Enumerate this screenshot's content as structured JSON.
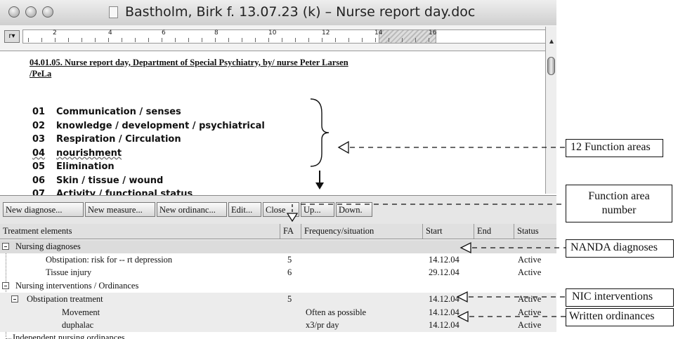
{
  "window": {
    "title": "Bastholm, Birk f. 13.07.23 (k) – Nurse report day.doc"
  },
  "ruler": {
    "button": "r▾",
    "numbers": [
      "2",
      "4",
      "6",
      "8",
      "10",
      "12",
      "14",
      "16"
    ]
  },
  "document": {
    "header": "04.01.05. Nurse report day, Department of Special Psychiatry, by/ nurse Peter Larsen /PeLa",
    "function_areas": [
      {
        "num": "01",
        "label": "Communication / senses"
      },
      {
        "num": "02",
        "label": "knowledge  / development / psychiatrical"
      },
      {
        "num": "03",
        "label": "Respiration / Circulation"
      },
      {
        "num": "04",
        "label": "nourishment"
      },
      {
        "num": "05",
        "label": "Elimination"
      },
      {
        "num": "06",
        "label": "Skin / tissue / wound"
      },
      {
        "num": "07",
        "label": "Activity / functional status"
      }
    ]
  },
  "toolbar": {
    "new_diagnose": "New diagnose...",
    "new_measure": "New measure...",
    "new_ordinance": "New ordinanc...",
    "edit": "Edit...",
    "close": "Close",
    "up": "Up...",
    "down": "Down."
  },
  "grid": {
    "columns": [
      "Treatment elements",
      "FA",
      "Frequency/situation",
      "Start",
      "End",
      "Status"
    ],
    "rows": [
      {
        "label": "Nursing diagnoses",
        "fa": "",
        "freq": "",
        "start": "",
        "end": "",
        "status": ""
      },
      {
        "label": "Obstipation: risk for -- rt depression",
        "fa": "5",
        "freq": "",
        "start": "14.12.04",
        "end": "",
        "status": "Active"
      },
      {
        "label": "Tissue injury",
        "fa": "6",
        "freq": "",
        "start": "29.12.04",
        "end": "",
        "status": "Active"
      },
      {
        "label": "Nursing interventions / Ordinances",
        "fa": "",
        "freq": "",
        "start": "",
        "end": "",
        "status": ""
      },
      {
        "label": "Obstipation treatment",
        "fa": "5",
        "freq": "",
        "start": "14.12.04",
        "end": "",
        "status": "Active"
      },
      {
        "label": "Movement",
        "fa": "",
        "freq": "Often as possible",
        "start": "14.12.04",
        "end": "",
        "status": "Active"
      },
      {
        "label": "duphalac",
        "fa": "",
        "freq": "x3/pr day",
        "start": "14.12.04",
        "end": "",
        "status": "Active"
      },
      {
        "label": "Independent nursing ordinances",
        "fa": "",
        "freq": "",
        "start": "",
        "end": "",
        "status": ""
      }
    ]
  },
  "annotations": {
    "function_areas": "12 Function areas",
    "function_area_number": "Function area\nnumber",
    "nanda": "NANDA diagnoses",
    "nic": "NIC interventions",
    "written": "Written ordinances"
  }
}
